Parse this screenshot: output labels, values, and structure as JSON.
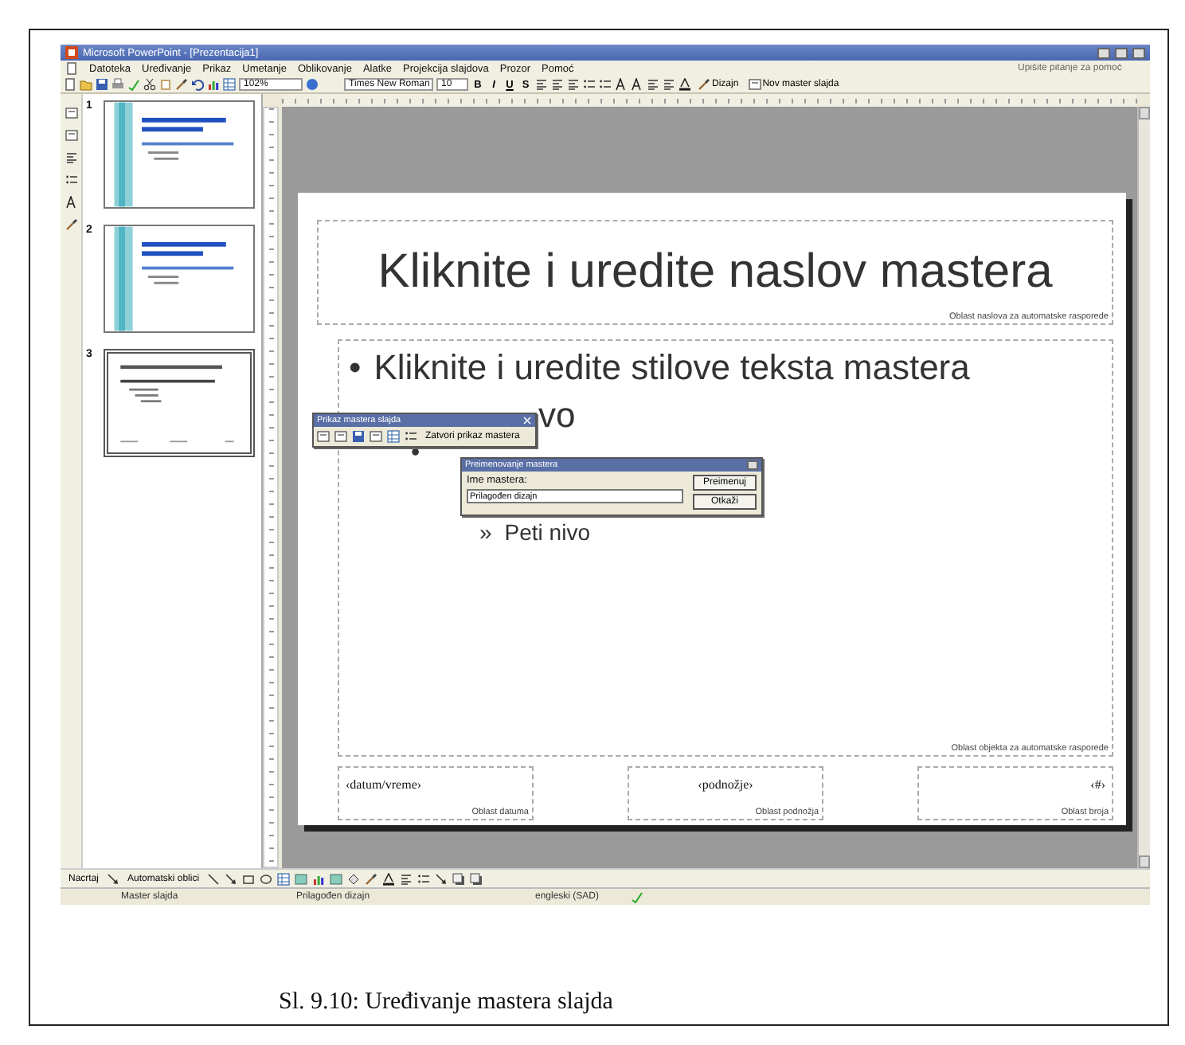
{
  "window": {
    "title": "Microsoft PowerPoint - [Prezentacija1]"
  },
  "menu": {
    "items": [
      "Datoteka",
      "Uređivanje",
      "Prikaz",
      "Umetanje",
      "Oblikovanje",
      "Alatke",
      "Projekcija slajdova",
      "Prozor",
      "Pomoć"
    ],
    "help_placeholder": "Upišite pitanje za pomoć"
  },
  "toolbar": {
    "zoom": "102%",
    "font": "Times New Roman",
    "size": "10",
    "format_buttons": [
      "B",
      "I",
      "U",
      "S"
    ],
    "design": "Dizajn",
    "new_master": "Nov master slajda"
  },
  "thumbnails": [
    {
      "number": "1",
      "kind": "design",
      "selected": false
    },
    {
      "number": "2",
      "kind": "design",
      "selected": false
    },
    {
      "number": "3",
      "kind": "plain",
      "selected": true
    }
  ],
  "slide": {
    "title": "Kliknite i uredite naslov mastera",
    "title_area_label": "Oblast naslova za automatske rasporede",
    "body": [
      {
        "bullet": "•",
        "text": "Kliknite i uredite stilove teksta mastera",
        "children": [
          {
            "text": "vo",
            "children": [
              {
                "bullet": "•",
                "children": [
                  {
                    "children": [
                      {
                        "bullet": "»",
                        "text": "Peti nivo"
                      }
                    ]
                  }
                ]
              }
            ]
          }
        ]
      }
    ],
    "body_area_label": "Oblast objekta za automatske rasporede",
    "footers": [
      {
        "text": "‹datum/vreme›",
        "label": "Oblast datuma"
      },
      {
        "text": "‹podnožje›",
        "label": "Oblast podnožja"
      },
      {
        "text": "‹#›",
        "label": "Oblast broja"
      }
    ]
  },
  "master_view_toolbar": {
    "title": "Prikaz mastera slajda",
    "close_button": "Zatvori prikaz mastera"
  },
  "rename_dialog": {
    "title": "Preimenovanje mastera",
    "label": "Ime mastera:",
    "value": "Prilagođen dizajn",
    "buttons": [
      "Preimenuj",
      "Otkaži"
    ]
  },
  "drawing_toolbar": {
    "draw": "Nacrtaj",
    "autoshapes": "Automatski oblici"
  },
  "status_bar": [
    "Master slajda",
    "Prilagođen dizajn",
    "engleski (SAD)"
  ],
  "caption": "Sl. 9.10: Uređivanje mastera slajda"
}
